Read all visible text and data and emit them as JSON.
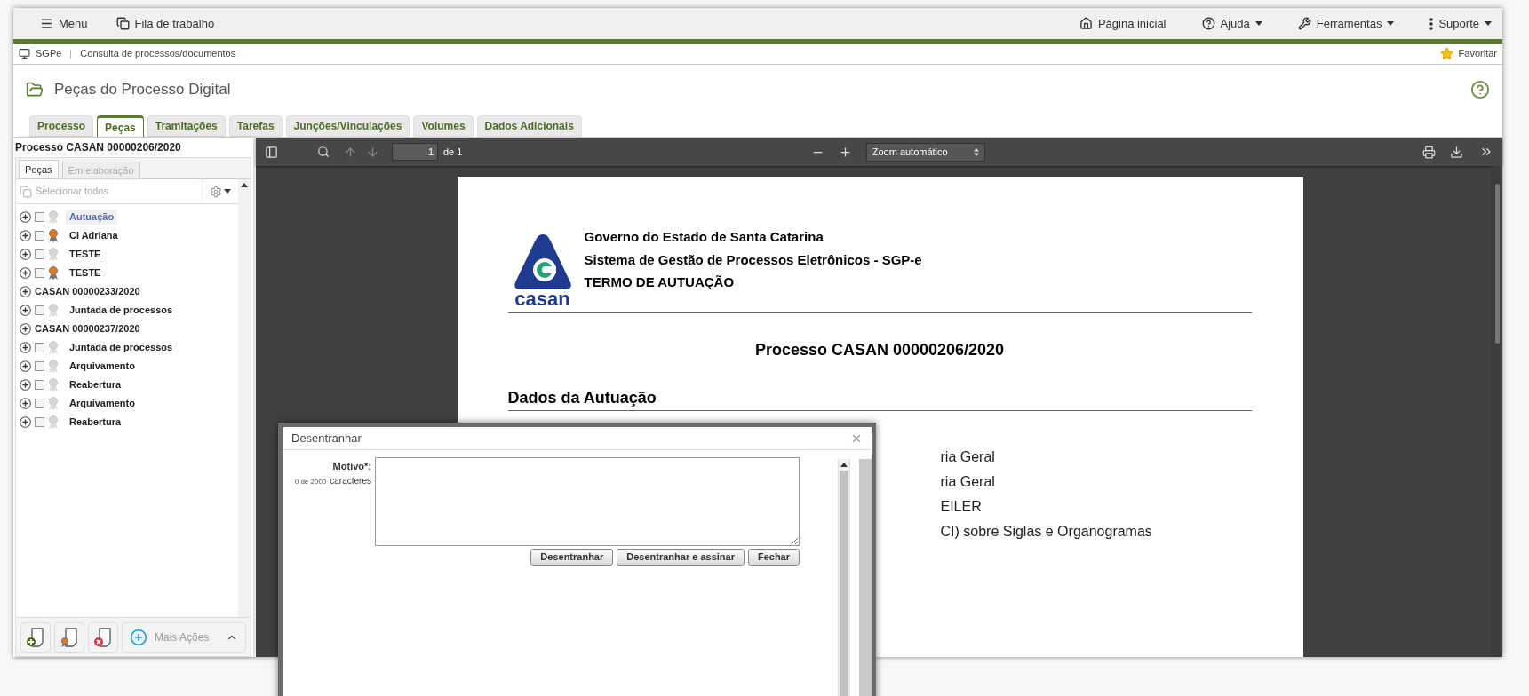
{
  "topbar": {
    "left": [
      {
        "kind": "menu",
        "label": "Menu"
      },
      {
        "kind": "queue",
        "label": "Fila de trabalho"
      }
    ],
    "right": [
      {
        "kind": "home",
        "label": "Página inicial",
        "dropdown": false
      },
      {
        "kind": "help",
        "label": "Ajuda",
        "dropdown": true
      },
      {
        "kind": "tools",
        "label": "Ferramentas",
        "dropdown": true
      },
      {
        "kind": "support",
        "label": "Suporte",
        "dropdown": true
      }
    ]
  },
  "breadcrumb": {
    "system": "SGPe",
    "page": "Consulta de processos/documentos",
    "favorite": "Favoritar"
  },
  "title": "Peças do Processo Digital",
  "tabs": [
    {
      "label": "Processo",
      "selected": false
    },
    {
      "label": "Peças",
      "selected": true
    },
    {
      "label": "Tramitações",
      "selected": false
    },
    {
      "label": "Tarefas",
      "selected": false
    },
    {
      "label": "Junções/Vinculações",
      "selected": false
    },
    {
      "label": "Volumes",
      "selected": false
    },
    {
      "label": "Dados Adicionais",
      "selected": false
    }
  ],
  "left_panel": {
    "heading": "Processo CASAN 00000206/2020",
    "tabs": [
      {
        "label": "Peças",
        "selected": true
      },
      {
        "label": "Em elaboração",
        "selected": false
      }
    ],
    "select_all": "Selecionar todos",
    "items": [
      {
        "kind": "doc",
        "label": "Autuação",
        "checked": false,
        "signed": false,
        "selected": true
      },
      {
        "kind": "doc",
        "label": "CI Adriana",
        "checked": false,
        "signed": true,
        "selected": false
      },
      {
        "kind": "doc",
        "label": "TESTE",
        "checked": false,
        "signed": false,
        "selected": false
      },
      {
        "kind": "doc",
        "label": "TESTE",
        "checked": false,
        "signed": true,
        "selected": false
      },
      {
        "kind": "process",
        "label": "CASAN 00000233/2020",
        "selected": false
      },
      {
        "kind": "doc",
        "label": "Juntada de processos",
        "checked": false,
        "signed": false,
        "selected": false
      },
      {
        "kind": "process",
        "label": "CASAN 00000237/2020",
        "selected": false
      },
      {
        "kind": "doc",
        "label": "Juntada de processos",
        "checked": false,
        "signed": false,
        "selected": false
      },
      {
        "kind": "doc",
        "label": "Arquivamento",
        "checked": false,
        "signed": false,
        "selected": false
      },
      {
        "kind": "doc",
        "label": "Reabertura",
        "checked": false,
        "signed": false,
        "selected": false
      },
      {
        "kind": "doc",
        "label": "Arquivamento",
        "checked": false,
        "signed": false,
        "selected": false
      },
      {
        "kind": "doc",
        "label": "Reabertura",
        "checked": false,
        "signed": false,
        "selected": false
      }
    ],
    "more_actions": "Mais Ações"
  },
  "viewer": {
    "page": "1",
    "page_count": "de 1",
    "zoom": "Zoom automático",
    "document": {
      "logo_text": "casan",
      "header": [
        "Governo do Estado de Santa Catarina",
        "Sistema de Gestão de Processos Eletrônicos - SGP-e",
        "TERMO DE AUTUAÇÃO"
      ],
      "heading": "Processo CASAN 00000206/2020",
      "section": "Dados da Autuação",
      "lines": [
        "ria Geral",
        "ria Geral",
        "EILER",
        "CI) sobre Siglas e Organogramas"
      ]
    }
  },
  "dialog": {
    "title": "Desentranhar",
    "field_label": "Motivo*:",
    "counter": "0 de 2000",
    "counter_unit": "caracteres",
    "buttons": [
      "Desentranhar",
      "Desentranhar e assinar",
      "Fechar"
    ]
  }
}
